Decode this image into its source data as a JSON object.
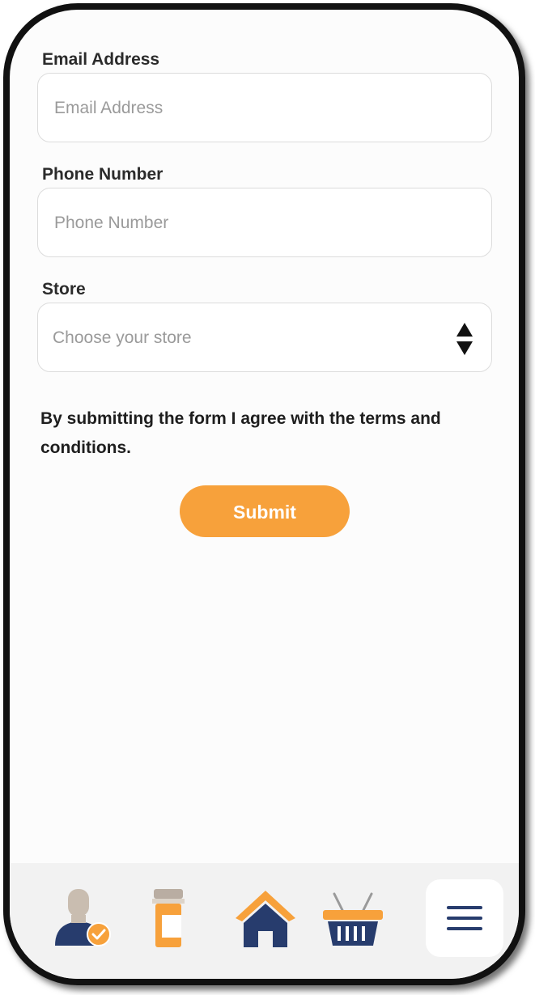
{
  "form": {
    "email": {
      "label": "Email Address",
      "placeholder": "Email Address",
      "value": ""
    },
    "phone": {
      "label": "Phone Number",
      "placeholder": "Phone Number",
      "value": ""
    },
    "store": {
      "label": "Store",
      "selected": "Choose your store"
    },
    "terms_text": "By submitting the form I agree with the terms and conditions.",
    "submit_label": "Submit"
  },
  "bottom_nav": {
    "items": [
      {
        "icon": "user-verified-icon"
      },
      {
        "icon": "pill-bottle-icon"
      },
      {
        "icon": "home-icon"
      },
      {
        "icon": "basket-icon"
      },
      {
        "icon": "menu-icon",
        "active": true
      }
    ]
  },
  "colors": {
    "accent": "#f7a13b",
    "navy": "#273c6d",
    "skin": "#c9bdb0",
    "nav_background": "#f2f2f2"
  }
}
